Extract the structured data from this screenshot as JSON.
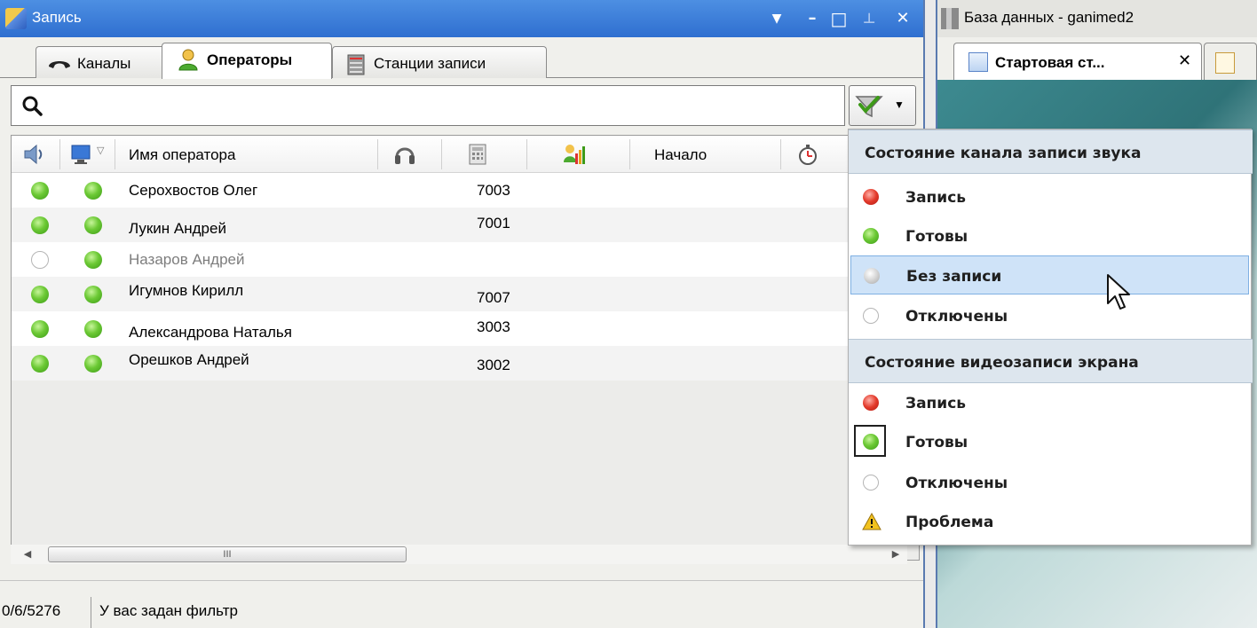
{
  "left_window": {
    "title": "Запись",
    "tabs": [
      {
        "label": "Каналы"
      },
      {
        "label": "Операторы"
      },
      {
        "label": "Станции записи"
      }
    ],
    "search": {
      "value": "",
      "placeholder": ""
    },
    "columns": {
      "operator_name": "Имя оператора",
      "start": "Начало"
    },
    "rows": [
      {
        "channel": "green",
        "screen": "green",
        "name": "Серохвостов Олег",
        "extension": "7003"
      },
      {
        "channel": "green",
        "screen": "green",
        "name": "Лукин Андрей",
        "extension": "7001"
      },
      {
        "channel": "off",
        "screen": "green",
        "name": "Назаров Андрей",
        "extension": ""
      },
      {
        "channel": "green",
        "screen": "green",
        "name": "Игумнов Кирилл",
        "extension": "7007"
      },
      {
        "channel": "green",
        "screen": "green",
        "name": "Александрова Наталья",
        "extension": "3003"
      },
      {
        "channel": "green",
        "screen": "green",
        "name": "Орешков Андрей",
        "extension": "3002"
      }
    ],
    "scrollbar_grip": "III",
    "status": {
      "counts": "0/6/5276",
      "message": "У вас задан фильтр"
    }
  },
  "right_window": {
    "title": "База данных - ganimed2",
    "tab_label": "Стартовая ст...",
    "tab_close": "✕"
  },
  "filter_dropdown": {
    "audio_section": {
      "title": "Состояние канала записи звука",
      "items": [
        {
          "label": "Запись",
          "state": "red"
        },
        {
          "label": "Готовы",
          "state": "green"
        },
        {
          "label": "Без записи",
          "state": "grey",
          "hovered": true
        },
        {
          "label": "Отключены",
          "state": "off"
        }
      ]
    },
    "video_section": {
      "title": "Состояние видеозаписи экрана",
      "items": [
        {
          "label": "Запись",
          "state": "red"
        },
        {
          "label": "Готовы",
          "state": "green",
          "focused": true
        },
        {
          "label": "Отключены",
          "state": "off"
        },
        {
          "label": "Проблема",
          "state": "warning"
        }
      ]
    }
  },
  "colors": {
    "titlebar_active": "#2f6fd0",
    "status_green": "#6cc935",
    "status_red": "#e33a2b",
    "hover_highlight": "#cfe3f8",
    "section_header": "#dde6ee"
  },
  "icons": {
    "title": "recording-app-icon",
    "search": "search-icon",
    "filter": "filter-icon",
    "speaker": "speaker-icon",
    "monitor": "monitor-icon",
    "headphones": "headphones-icon",
    "phone": "phone-keypad-icon",
    "activity": "activity-icon",
    "timer": "stopwatch-icon",
    "warning": "warning-icon"
  }
}
